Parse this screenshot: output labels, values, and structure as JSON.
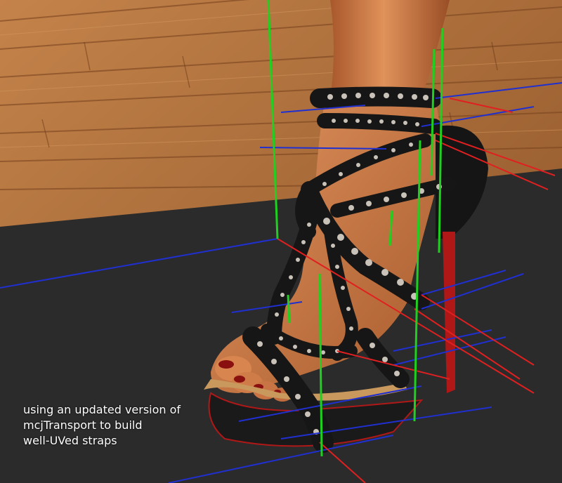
{
  "caption": {
    "line1": "using an updated version of",
    "line2": "mcjTransport to build",
    "line3": "well-UVed straps"
  },
  "colors": {
    "floor": "#b8743a",
    "floor_dark": "#8a5227",
    "ground": "#2b2b2b",
    "skin": "#d8834a",
    "skin_dark": "#9c5228",
    "strap": "#1a1a1a",
    "stud": "#c9c2b8",
    "sole": "#b01818",
    "nail": "#8a1010",
    "axis_x": "#e02020",
    "axis_y": "#20d020",
    "axis_z": "#2030d0"
  }
}
